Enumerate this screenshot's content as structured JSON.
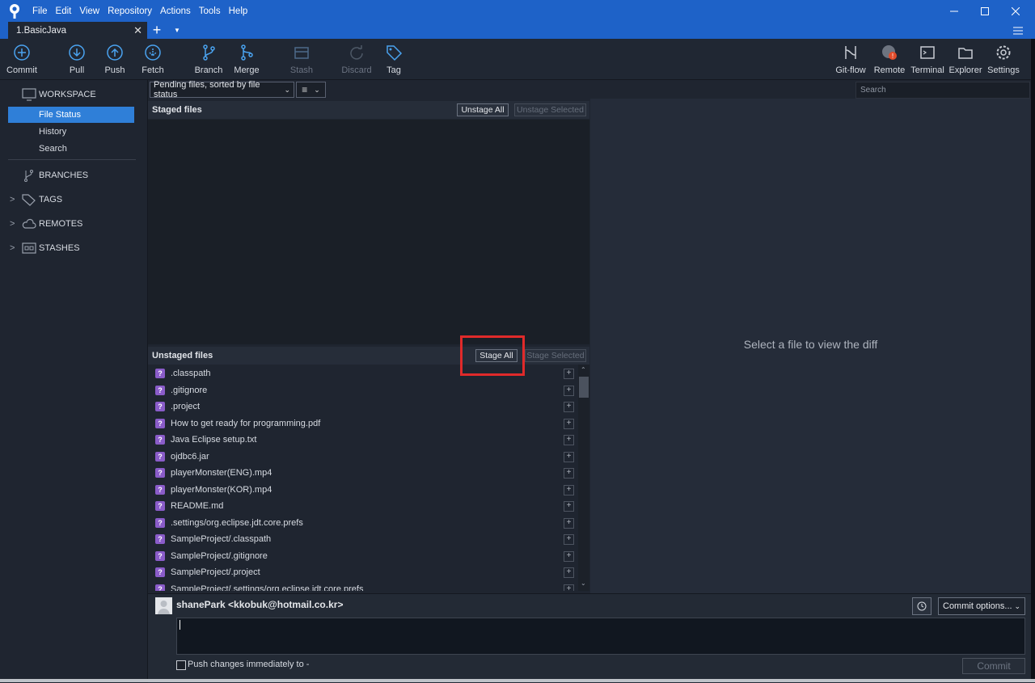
{
  "app": {
    "tab_title": "1.BasicJava"
  },
  "menu": [
    "File",
    "Edit",
    "View",
    "Repository",
    "Actions",
    "Tools",
    "Help"
  ],
  "toolbar": {
    "commit": "Commit",
    "pull": "Pull",
    "push": "Push",
    "fetch": "Fetch",
    "branch": "Branch",
    "merge": "Merge",
    "stash": "Stash",
    "discard": "Discard",
    "tag": "Tag",
    "gitflow": "Git-flow",
    "remote": "Remote",
    "terminal": "Terminal",
    "explorer": "Explorer",
    "settings": "Settings"
  },
  "sidebar": {
    "workspace": "WORKSPACE",
    "items": [
      "File Status",
      "History",
      "Search"
    ],
    "branches": "BRANCHES",
    "tags": "TAGS",
    "remotes": "REMOTES",
    "stashes": "STASHES"
  },
  "filter": {
    "label": "Pending files, sorted by file status"
  },
  "search": {
    "placeholder": "Search"
  },
  "staged": {
    "title": "Staged files",
    "unstage_all": "Unstage All",
    "unstage_selected": "Unstage Selected"
  },
  "unstaged": {
    "title": "Unstaged files",
    "stage_all": "Stage All",
    "stage_selected": "Stage Selected",
    "files": [
      ".classpath",
      ".gitignore",
      ".project",
      "How to get ready for programming.pdf",
      "Java Eclipse setup.txt",
      "ojdbc6.jar",
      "playerMonster(ENG).mp4",
      "playerMonster(KOR).mp4",
      "README.md",
      ".settings/org.eclipse.jdt.core.prefs",
      "SampleProject/.classpath",
      "SampleProject/.gitignore",
      "SampleProject/.project",
      "SampleProject/.settings/org.eclipse.jdt.core.prefs"
    ]
  },
  "diff": {
    "message": "Select a file to view the diff"
  },
  "commit": {
    "author": "shanePark <kkobuk@hotmail.co.kr>",
    "options": "Commit options...",
    "push_label": "Push changes immediately to -",
    "button": "Commit"
  },
  "colors": {
    "titlebar": "#1e62c8",
    "selected": "#2f7fd8",
    "highlight": "#e02a2a",
    "untracked": "#8a5cc9"
  }
}
